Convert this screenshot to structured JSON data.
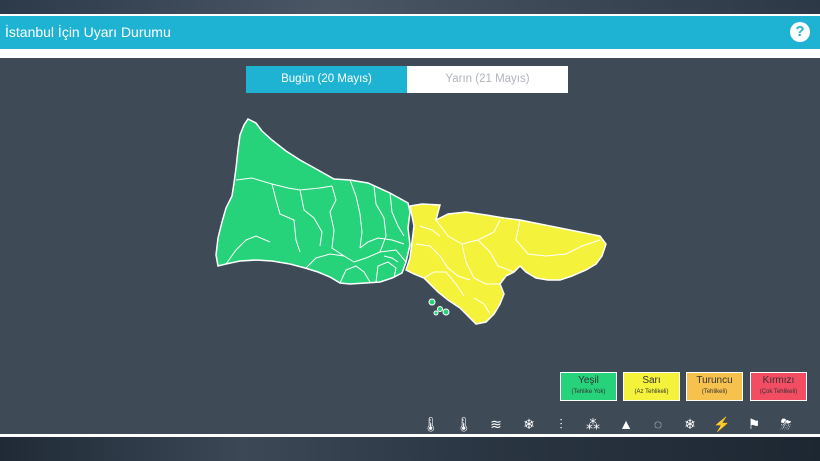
{
  "header": {
    "title": "İstanbul İçin Uyarı Durumu",
    "help_icon": "?"
  },
  "tabs": {
    "today": "Bugün (20 Mayıs)",
    "tomorrow": "Yarın (21 Mayıs)"
  },
  "colors": {
    "green": "#26d37b",
    "yellow": "#f4f23a",
    "orange": "#f6c14d",
    "red": "#f24d63"
  },
  "legend": [
    {
      "label": "Yeşil",
      "sub": "(Tehlike Yok)"
    },
    {
      "label": "Sarı",
      "sub": "(Az Tehlikeli)"
    },
    {
      "label": "Turuncu",
      "sub": "(Tehlikeli)"
    },
    {
      "label": "Kırmızı",
      "sub": "(Çok Tehlikeli)"
    }
  ],
  "hazard_icons": [
    {
      "name": "cold-temperature-icon",
      "glyph": "🌡"
    },
    {
      "name": "hot-temperature-icon",
      "glyph": "🌡"
    },
    {
      "name": "fog-icon",
      "glyph": "≋"
    },
    {
      "name": "snow-ice-icon",
      "glyph": "❄"
    },
    {
      "name": "rain-icon",
      "glyph": "⫶"
    },
    {
      "name": "hail-icon",
      "glyph": "⁂"
    },
    {
      "name": "avalanche-icon",
      "glyph": "▲"
    },
    {
      "name": "dust-icon",
      "glyph": "◌"
    },
    {
      "name": "snowflake-icon",
      "glyph": "❄"
    },
    {
      "name": "lightning-icon",
      "glyph": "⚡"
    },
    {
      "name": "wind-icon",
      "glyph": "⚑"
    },
    {
      "name": "rainstorm-icon",
      "glyph": "⛈"
    }
  ]
}
